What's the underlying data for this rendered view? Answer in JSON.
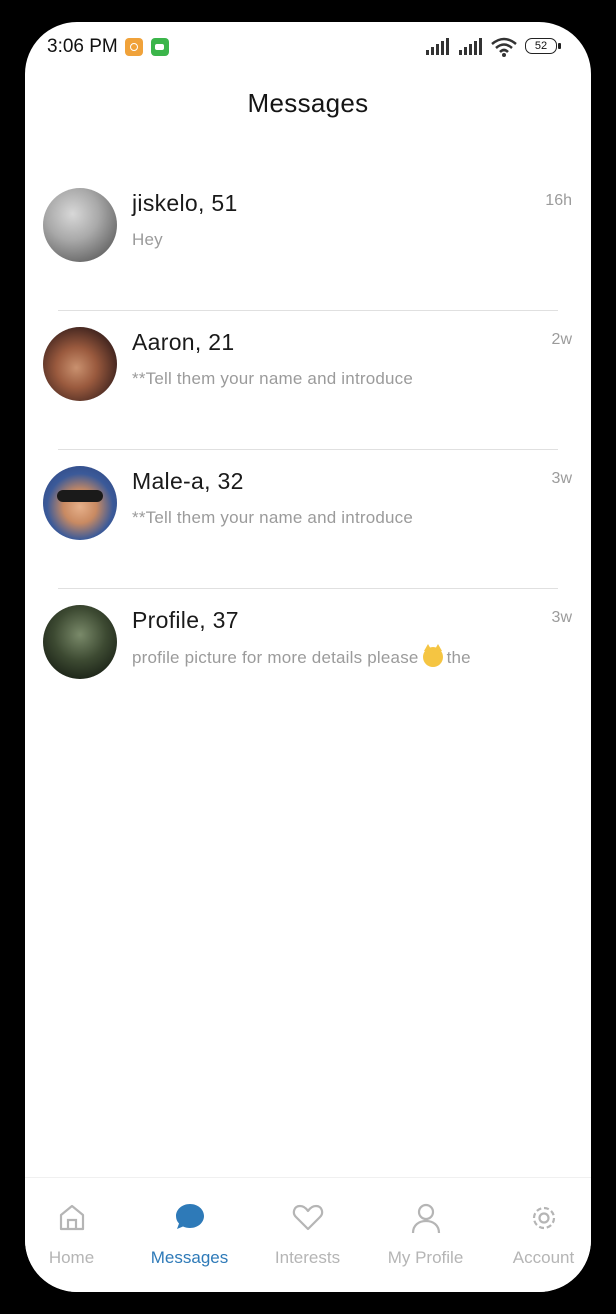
{
  "status_bar": {
    "time": "3:06 PM",
    "battery": "52"
  },
  "page_title": "Messages",
  "conversations": [
    {
      "name": "jiskelo, 51",
      "preview": "Hey",
      "time": "16h"
    },
    {
      "name": "Aaron, 21",
      "preview": "**Tell them your name and introduce",
      "time": "2w"
    },
    {
      "name": "Male-a, 32",
      "preview": "**Tell them your name and introduce",
      "time": "3w"
    },
    {
      "name": "Profile, 37",
      "preview_before": "profile picture for more details please",
      "preview_after": "the",
      "time": "3w"
    }
  ],
  "tabbar": {
    "home": "Home",
    "messages": "Messages",
    "interests": "Interests",
    "my_profile": "My Profile",
    "account": "Account",
    "active_color": "#2e7ab8",
    "inactive_color": "#b5b5b5"
  }
}
